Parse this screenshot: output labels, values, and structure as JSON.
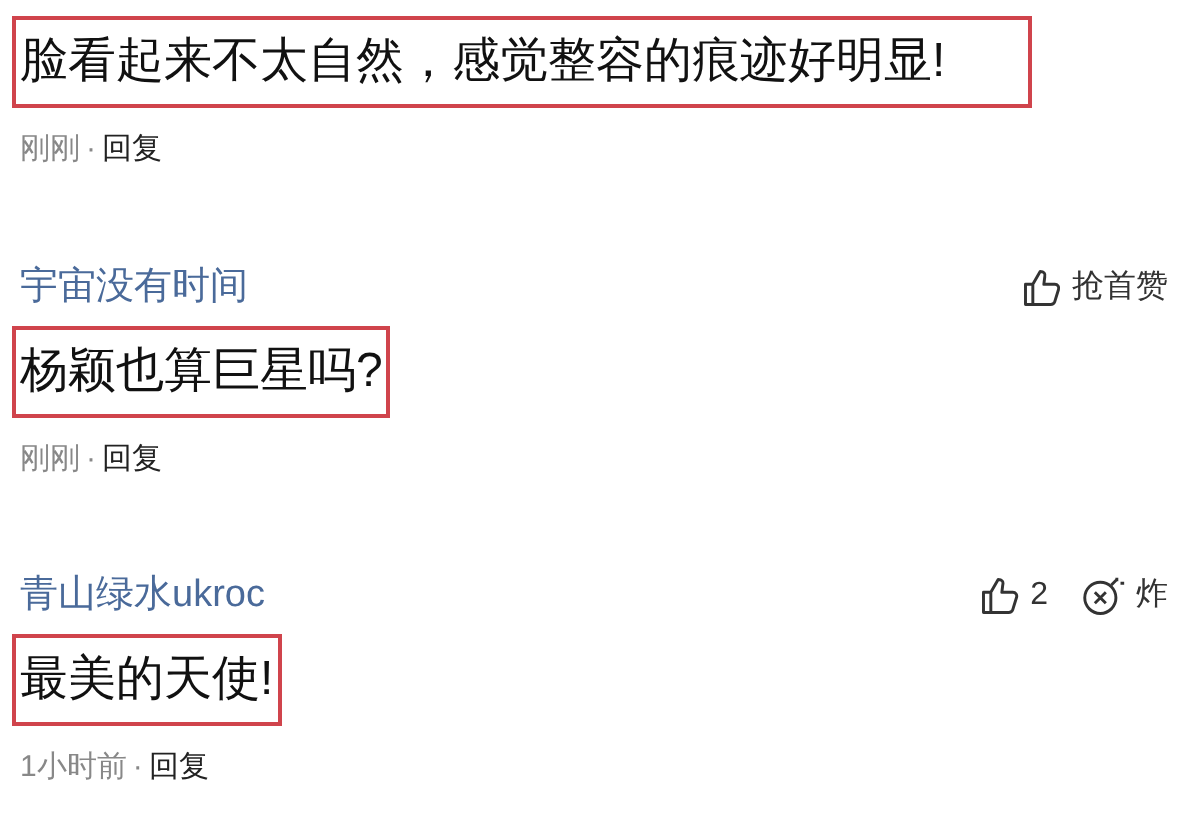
{
  "comments": [
    {
      "text": "脸看起来不太自然，感觉整容的痕迹好明显!",
      "highlighted": true,
      "time": "刚刚",
      "separator": "·",
      "reply": "回复"
    },
    {
      "author": "宇宙没有时间",
      "text": "杨颖也算巨星吗?",
      "highlighted": true,
      "time": "刚刚",
      "separator": "·",
      "reply": "回复",
      "actions": [
        {
          "kind": "like",
          "label": "抢首赞"
        }
      ]
    },
    {
      "author": "青山绿水ukroc",
      "text": "最美的天使!",
      "highlighted": true,
      "time": "1小时前",
      "separator": "·",
      "reply": "回复",
      "actions": [
        {
          "kind": "like",
          "label": "2"
        },
        {
          "kind": "bomb",
          "label": "炸"
        }
      ]
    }
  ]
}
